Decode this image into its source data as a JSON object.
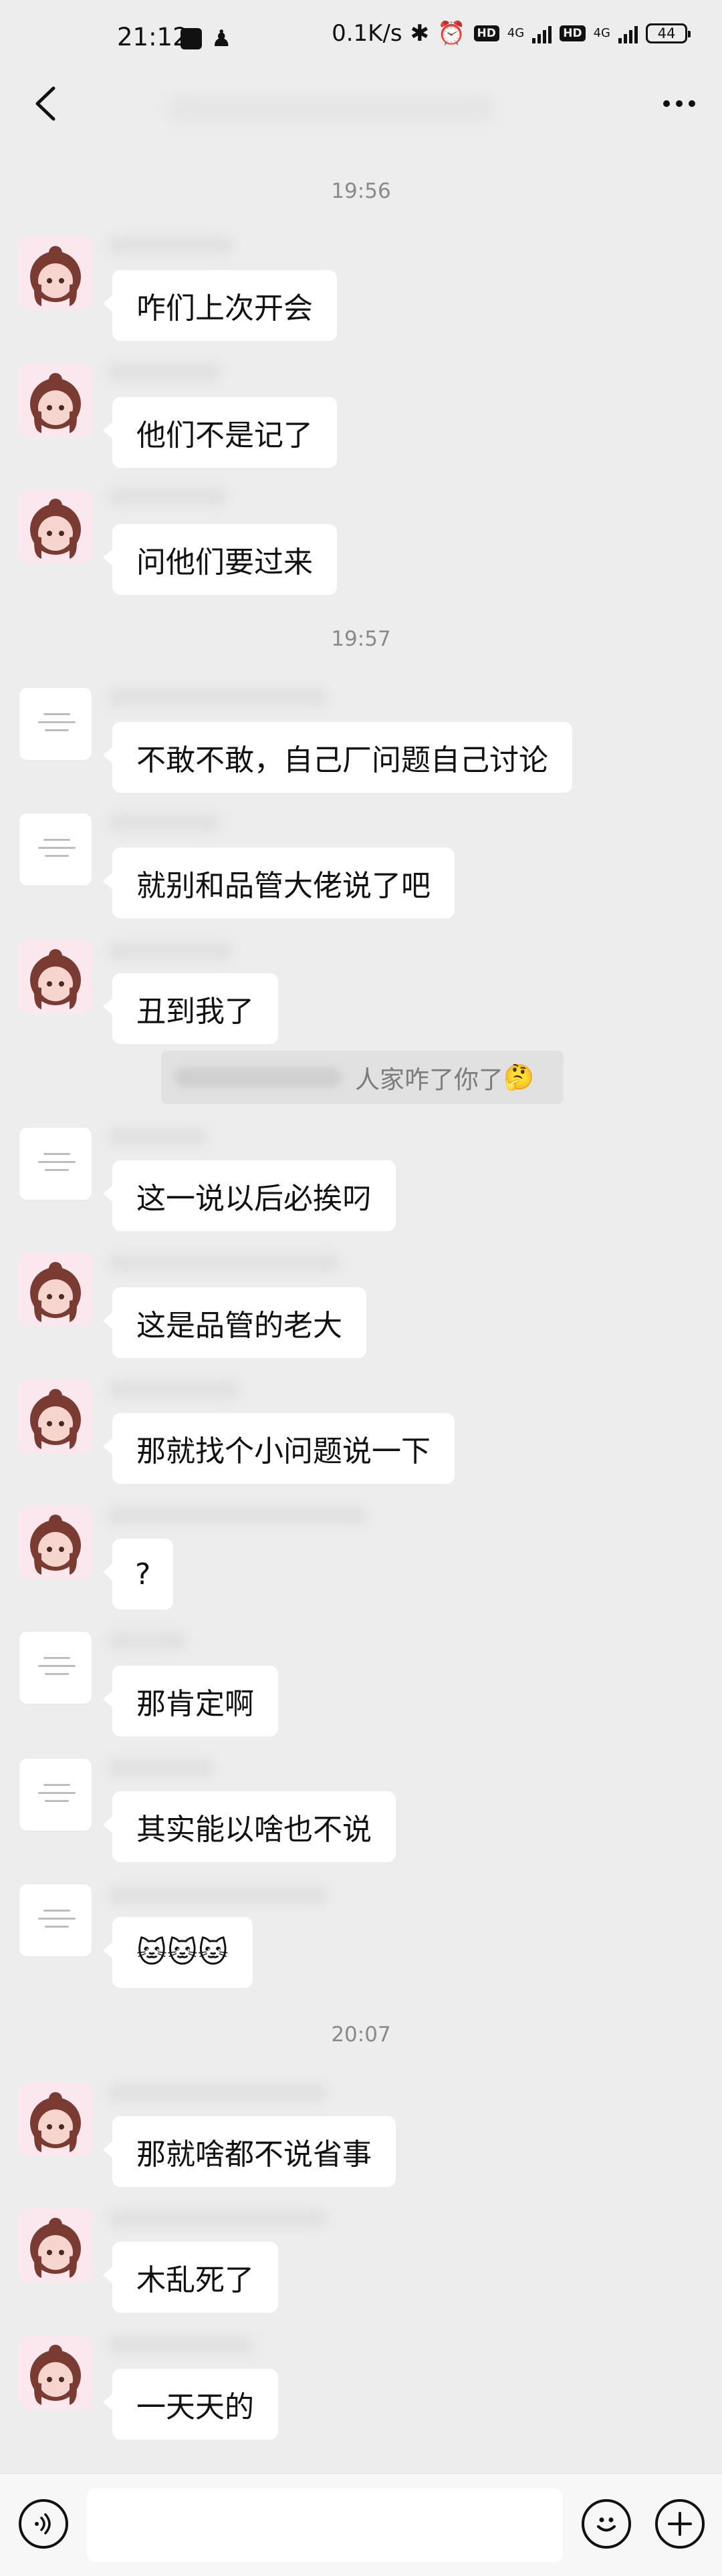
{
  "status_bar": {
    "time": "21:12",
    "speed": "0.1K/s",
    "hd_label": "HD",
    "network_label": "4G",
    "battery": "44"
  },
  "timestamps": [
    "19:56",
    "19:57",
    "20:07"
  ],
  "messages": [
    {
      "text": "咋们上次开会",
      "avatar": "girl-avatar"
    },
    {
      "text": "他们不是记了",
      "avatar": "girl-avatar"
    },
    {
      "text": "问他们要过来",
      "avatar": "girl-avatar"
    },
    {
      "text": "不敢不敢，自己厂问题自己讨论",
      "avatar": "document-avatar"
    },
    {
      "text": "就别和品管大佬说了吧",
      "avatar": "document-avatar"
    },
    {
      "text": "丑到我了",
      "avatar": "girl-avatar"
    },
    {
      "text": "这一说以后必挨叼",
      "avatar": "document-avatar"
    },
    {
      "text": "这是品管的老大",
      "avatar": "girl-avatar"
    },
    {
      "text": "那就找个小问题说一下",
      "avatar": "girl-avatar"
    },
    {
      "text": "?",
      "avatar": "girl-avatar"
    },
    {
      "text": "那肯定啊",
      "avatar": "document-avatar"
    },
    {
      "text": "其实能以啥也不说",
      "avatar": "document-avatar"
    },
    {
      "text": "🐱🐱🐱",
      "avatar": "document-avatar"
    },
    {
      "text": "那就啥都不说省事",
      "avatar": "girl-avatar"
    },
    {
      "text": "木乱死了",
      "avatar": "girl-avatar"
    },
    {
      "text": "一天天的",
      "avatar": "girl-avatar"
    }
  ],
  "quote": {
    "text": "人家咋了你了",
    "emoji": "🤔"
  },
  "input": {
    "placeholder": ""
  },
  "icons": [
    "back-arrow-icon",
    "more-icon",
    "voice-icon",
    "emoji-icon",
    "plus-icon"
  ]
}
